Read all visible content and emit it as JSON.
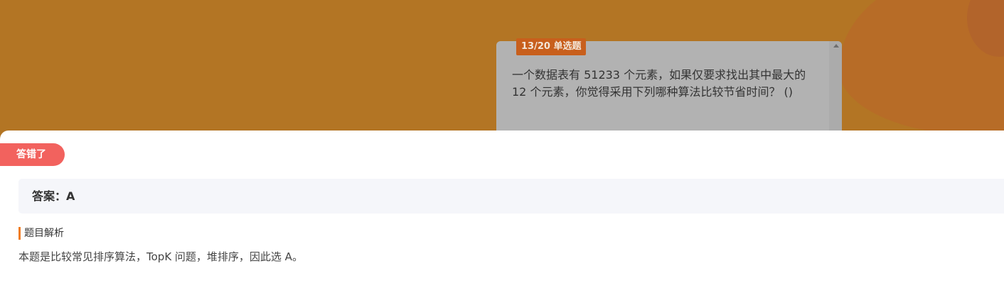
{
  "question": {
    "tag": "13/20 单选题",
    "text": "一个数据表有 51233 个元素，如果仅要求找出其中最大的 12 个元素，你觉得采用下列哪种算法比较节省时间？ ()"
  },
  "result": {
    "status_badge": "答错了",
    "answer": "答案：A",
    "analysis_heading": "题目解析",
    "analysis_text": "本题是比较常见排序算法，TopK 问题，堆排序，因此选 A。"
  },
  "colors": {
    "backdrop": "#b37524",
    "tag": "#c85f1c",
    "wrong_badge": "#f2625e",
    "heading_accent": "#f07c22"
  }
}
